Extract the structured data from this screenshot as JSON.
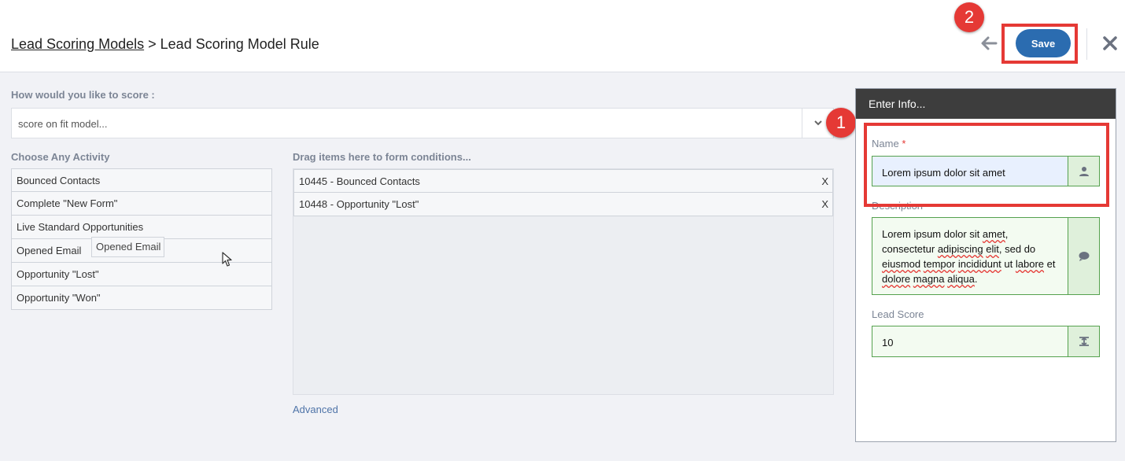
{
  "header": {
    "breadcrumb_root": "Lead Scoring Models",
    "breadcrumb_sep": ">",
    "breadcrumb_current": "Lead Scoring Model Rule",
    "save_label": "Save",
    "back_icon": "arrow-left-icon",
    "close_icon": "close-icon"
  },
  "annotations": {
    "badge_1": "1",
    "badge_2": "2",
    "highlight_color": "#e53935"
  },
  "scoring": {
    "label": "How would you like to score :",
    "selected": "score on fit model..."
  },
  "activities": {
    "label": "Choose Any Activity",
    "items": [
      "Bounced Contacts",
      "Complete \"New Form\"",
      "Live Standard Opportunities",
      "Opened Email",
      "Opportunity \"Lost\"",
      "Opportunity \"Won\""
    ],
    "dragging": "Opened Email"
  },
  "conditions": {
    "label": "Drag items here to form conditions...",
    "items": [
      "10445 - Bounced Contacts",
      "10448 - Opportunity \"Lost\""
    ],
    "remove_label": "X",
    "advanced_link": "Advanced"
  },
  "info_panel": {
    "title": "Enter Info...",
    "name_label": "Name",
    "name_required": "*",
    "name_value": "Lorem ipsum dolor sit amet",
    "name_icon": "user-icon",
    "description_label": "Description",
    "description_value": "Lorem ipsum dolor sit amet, consectetur adipiscing elit, sed do eiusmod tempor incididunt ut labore et dolore magna aliqua.",
    "description_icon": "comment-icon",
    "lead_score_label": "Lead Score",
    "lead_score_value": "10",
    "lead_score_icon": "text-height-icon"
  },
  "colors": {
    "save_button": "#2b6cb0",
    "panel_header": "#3d3d3d",
    "field_border": "#55a14e"
  }
}
